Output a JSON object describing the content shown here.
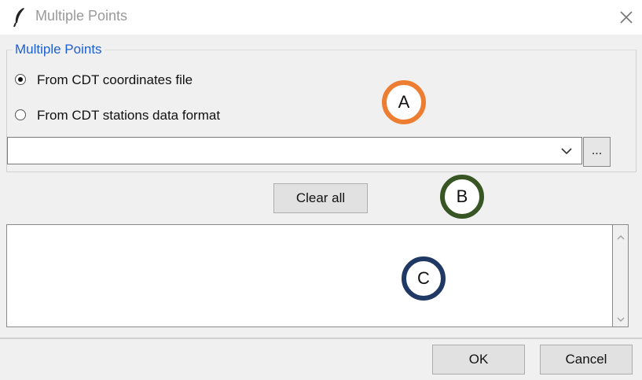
{
  "window": {
    "title": "Multiple Points",
    "icon": "feather-icon",
    "close_icon": "close-icon"
  },
  "group": {
    "legend": "Multiple Points",
    "options": [
      {
        "label": "From CDT coordinates file",
        "selected": true
      },
      {
        "label": "From CDT stations data format",
        "selected": false
      }
    ],
    "combo_value": "",
    "browse_label": "..."
  },
  "clear_label": "Clear all",
  "text_area_value": "",
  "buttons": {
    "ok": "OK",
    "cancel": "Cancel"
  },
  "annotations": [
    {
      "label": "A",
      "color": "#ed7d31"
    },
    {
      "label": "B",
      "color": "#375623"
    },
    {
      "label": "C",
      "color": "#1f3864"
    }
  ]
}
